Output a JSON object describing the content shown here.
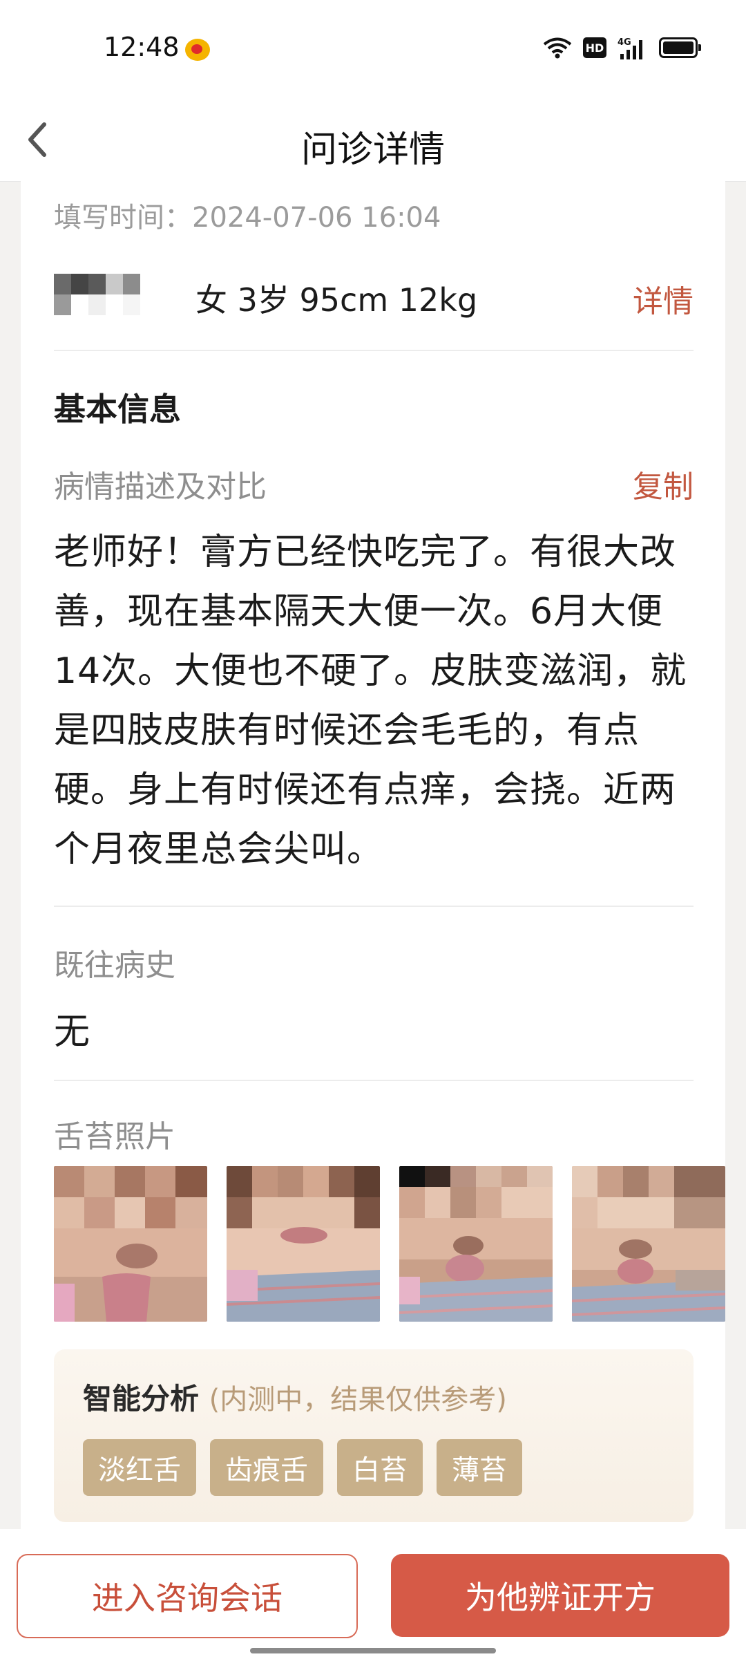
{
  "status_bar": {
    "time": "12:48",
    "hd": "HD",
    "network": "4G"
  },
  "header": {
    "title": "问诊详情"
  },
  "record": {
    "fill_time_label": "填写时间：",
    "fill_time": "2024-07-06 16:04",
    "patient_info": "女 3岁 95cm 12kg",
    "detail_link": "详情"
  },
  "basic_info": {
    "section_title": "基本信息",
    "description_label": "病情描述及对比",
    "copy_label": "复制",
    "description": "老师好！膏方已经快吃完了。有很大改善，现在基本隔天大便一次。6月大便14次。大便也不硬了。皮肤变滋润，就是四肢皮肤有时候还会毛毛的，有点硬。身上有时候还有点痒，会挠。近两个月夜里总会尖叫。",
    "history_label": "既往病史",
    "history_value": "无",
    "tongue_photos_label": "舌苔照片"
  },
  "analysis": {
    "title": "智能分析",
    "subtitle": "(内测中，结果仅供参考)",
    "tags": [
      "淡红舌",
      "齿痕舌",
      "白苔",
      "薄苔"
    ]
  },
  "actions": {
    "enter_chat": "进入咨询会话",
    "prescribe": "为他辨证开方"
  }
}
